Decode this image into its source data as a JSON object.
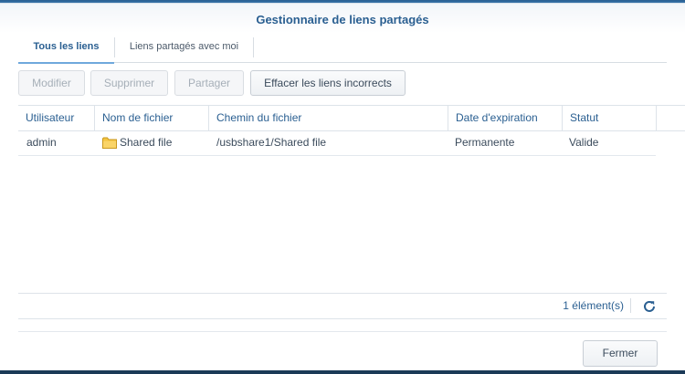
{
  "window": {
    "title": "Gestionnaire de liens partagés"
  },
  "tabs": [
    {
      "label": "Tous les liens",
      "active": true
    },
    {
      "label": "Liens partagés avec moi",
      "active": false
    }
  ],
  "toolbar": {
    "edit_label": "Modifier",
    "delete_label": "Supprimer",
    "share_label": "Partager",
    "clear_invalid_label": "Effacer les liens incorrects"
  },
  "grid": {
    "columns": [
      "Utilisateur",
      "Nom de fichier",
      "Chemin du fichier",
      "Date d'expiration",
      "Statut"
    ],
    "rows": [
      {
        "user": "admin",
        "file_name": "Shared file",
        "file_path": "/usbshare1/Shared file",
        "expiration": "Permanente",
        "status": "Valide"
      }
    ]
  },
  "statusbar": {
    "count": "1 élément(s)"
  },
  "footer": {
    "close_label": "Fermer"
  },
  "colors": {
    "accent": "#2a5f91",
    "folder": "#f4c542"
  },
  "icons": {
    "file": "folder-icon",
    "refresh": "refresh-icon"
  }
}
